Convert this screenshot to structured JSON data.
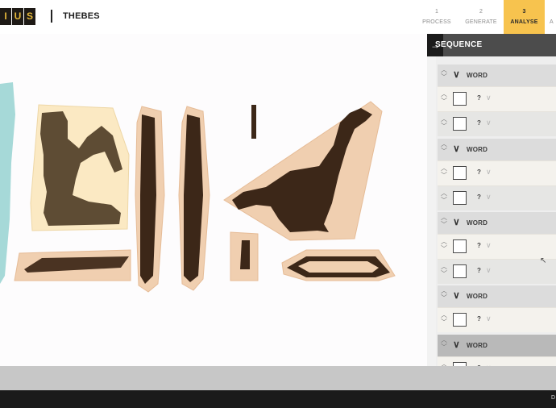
{
  "header": {
    "logo_letters": [
      "I",
      "U",
      "S"
    ],
    "site_name": "THEBES",
    "steps": [
      {
        "num": "1",
        "label": "PROCESS",
        "active": false
      },
      {
        "num": "2",
        "label": "GENERATE",
        "active": false
      },
      {
        "num": "3",
        "label": "ANALYSE",
        "active": true
      },
      {
        "num": "",
        "label": "A",
        "active": false
      }
    ]
  },
  "panel": {
    "title": "SEQUENCE",
    "collapse_icon": "arrow-right-icon",
    "words": [
      {
        "label": "WORD",
        "glyphs": [
          {
            "value": "?"
          },
          {
            "value": "?"
          }
        ]
      },
      {
        "label": "WORD",
        "glyphs": [
          {
            "value": "?"
          },
          {
            "value": "?"
          }
        ]
      },
      {
        "label": "WORD",
        "glyphs": [
          {
            "value": "?"
          },
          {
            "value": "?"
          }
        ]
      },
      {
        "label": "WORD",
        "glyphs": [
          {
            "value": "?"
          }
        ]
      },
      {
        "label": "WORD",
        "glyphs": [
          {
            "value": "?"
          }
        ]
      }
    ]
  },
  "footer": {
    "text": "D"
  },
  "colors": {
    "accent": "#f7c34e",
    "dark": "#1b1b1b",
    "panel_header": "#4c4c4c",
    "glyph_fill": "#4a3322",
    "glyph_highlight": "#f0cfb0"
  }
}
